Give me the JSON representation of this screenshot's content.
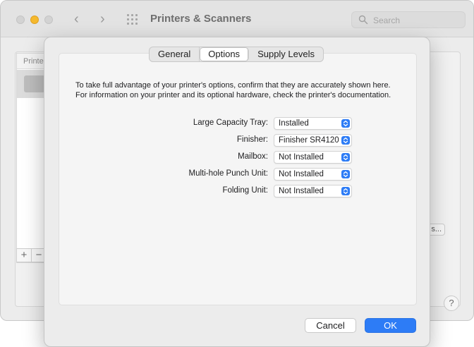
{
  "window": {
    "title": "Printers & Scanners",
    "search_placeholder": "Search",
    "list_header": "Printe",
    "add_label": "+",
    "remove_label": "−",
    "options_button_fragment": "s...",
    "help_label": "?"
  },
  "dialog": {
    "tabs": [
      {
        "label": "General",
        "selected": false
      },
      {
        "label": "Options",
        "selected": true
      },
      {
        "label": "Supply Levels",
        "selected": false
      }
    ],
    "intro": "To take full advantage of your printer's options, confirm that they are accurately shown here. For information on your printer and its optional hardware, check the printer's documentation.",
    "options": [
      {
        "label": "Large Capacity Tray:",
        "value": "Installed"
      },
      {
        "label": "Finisher:",
        "value": "Finisher SR4120"
      },
      {
        "label": "Mailbox:",
        "value": "Not Installed"
      },
      {
        "label": "Multi-hole Punch Unit:",
        "value": "Not Installed"
      },
      {
        "label": "Folding Unit:",
        "value": "Not Installed"
      }
    ],
    "cancel_label": "Cancel",
    "ok_label": "OK"
  },
  "colors": {
    "accent": "#2d7cf6",
    "minimize_light": "#f5b92d"
  }
}
